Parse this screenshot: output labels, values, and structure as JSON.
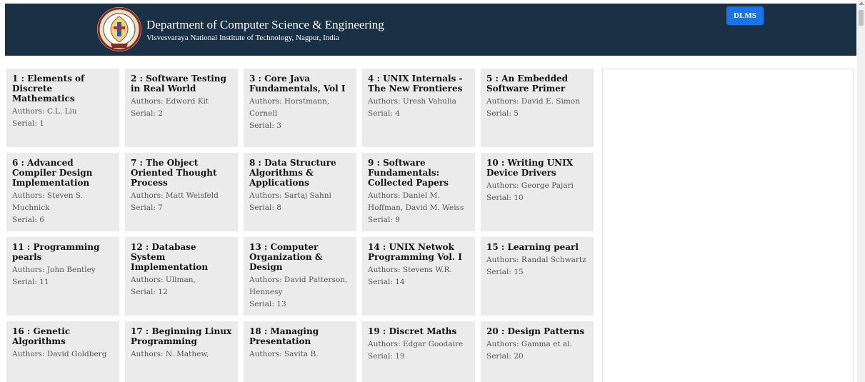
{
  "header": {
    "title": "Department of Computer Science & Engineering",
    "subtitle": "Visvesvaraya National Institute of Technology, Nagpur, India",
    "dlms_label": "DLMS",
    "background_color": "#1a3044",
    "button_color": "#1a73e8"
  },
  "books": [
    {
      "title": "1 : Elements of Discrete Mathematics",
      "authors": "Authors: C.L. Liu",
      "serial": "Serial: 1"
    },
    {
      "title": "2 : Software Testing in Real World",
      "authors": "Authors: Edword Kit",
      "serial": "Serial: 2"
    },
    {
      "title": "3 : Core Java Fundamentals, Vol I",
      "authors": "Authors: Horstmann, Cornell",
      "serial": "Serial: 3"
    },
    {
      "title": "4 : UNIX Internals - The New Frontieres",
      "authors": "Authors: Uresh Vahulia",
      "serial": "Serial: 4"
    },
    {
      "title": "5 : An Embedded Software Primer",
      "authors": "Authors: David E. Simon",
      "serial": "Serial: 5"
    },
    {
      "title": "6 : Advanced Compiler Design Implementation",
      "authors": "Authors: Steven S. Muchnick",
      "serial": "Serial: 6"
    },
    {
      "title": "7 : The Object Oriented Thought Process",
      "authors": "Authors: Matt Weisfeld",
      "serial": "Serial: 7"
    },
    {
      "title": "8 : Data Structure Algorithms & Applications",
      "authors": "Authors: Sartaj Sahni",
      "serial": "Serial: 8"
    },
    {
      "title": "9 : Software Fundamentals: Collected Papers",
      "authors": "Authors: Daniel M. Hoffman, David M. Weiss",
      "serial": "Serial: 9"
    },
    {
      "title": "10 : Writing UNIX Device Drivers",
      "authors": "Authors: George Pajari",
      "serial": "Serial: 10"
    },
    {
      "title": "11 : Programming pearls",
      "authors": "Authors: John Bentley",
      "serial": "Serial: 11"
    },
    {
      "title": "12 : Database System Implementation",
      "authors": "Authors: Ullman,",
      "serial": "Serial: 12"
    },
    {
      "title": "13 : Computer Organization & Design",
      "authors": "Authors: David Patterson, Hennesy",
      "serial": "Serial: 13"
    },
    {
      "title": "14 : UNIX Netwok Programming Vol. I",
      "authors": "Authors: Stevens W.R.",
      "serial": "Serial: 14"
    },
    {
      "title": "15 : Learning pearl",
      "authors": "Authors: Randal Schwartz",
      "serial": "Serial: 15"
    },
    {
      "title": "16 : Genetic Algorithms",
      "authors": "Authors: David Goldberg",
      "serial": ""
    },
    {
      "title": "17 : Beginning Linux Programming",
      "authors": "Authors: N. Mathew,",
      "serial": ""
    },
    {
      "title": "18 : Managing Presentation",
      "authors": "Authors: Savita B.",
      "serial": ""
    },
    {
      "title": "19 : Discret Maths",
      "authors": "Authors: Edgar Goodaire",
      "serial": "Serial: 19"
    },
    {
      "title": "20 : Design Patterns",
      "authors": "Authors: Gamma et al.",
      "serial": "Serial: 20"
    }
  ]
}
